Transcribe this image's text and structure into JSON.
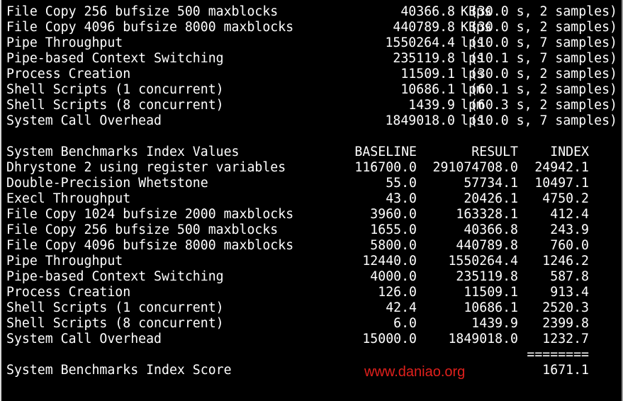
{
  "results": [
    {
      "name": "File Copy 256 bufsize 500 maxblocks",
      "value": "40366.8",
      "unit": "KBps",
      "note": "(30.0 s, 2 samples)"
    },
    {
      "name": "File Copy 4096 bufsize 8000 maxblocks",
      "value": "440789.8",
      "unit": "KBps",
      "note": "(30.0 s, 2 samples)"
    },
    {
      "name": "Pipe Throughput",
      "value": "1550264.4",
      "unit": "lps",
      "note": "(10.0 s, 7 samples)"
    },
    {
      "name": "Pipe-based Context Switching",
      "value": "235119.8",
      "unit": "lps",
      "note": "(10.1 s, 7 samples)"
    },
    {
      "name": "Process Creation",
      "value": "11509.1",
      "unit": "lps",
      "note": "(30.0 s, 2 samples)"
    },
    {
      "name": "Shell Scripts (1 concurrent)",
      "value": "10686.1",
      "unit": "lpm",
      "note": "(60.1 s, 2 samples)"
    },
    {
      "name": "Shell Scripts (8 concurrent)",
      "value": "1439.9",
      "unit": "lpm",
      "note": "(60.3 s, 2 samples)"
    },
    {
      "name": "System Call Overhead",
      "value": "1849018.0",
      "unit": "lps",
      "note": "(10.0 s, 7 samples)"
    }
  ],
  "index_table": {
    "title": "System Benchmarks Index Values",
    "headers": {
      "baseline": "BASELINE",
      "result": "RESULT",
      "index": "INDEX"
    },
    "rows": [
      {
        "name": "Dhrystone 2 using register variables",
        "baseline": "116700.0",
        "result": "291074708.0",
        "index": "24942.1"
      },
      {
        "name": "Double-Precision Whetstone",
        "baseline": "55.0",
        "result": "57734.1",
        "index": "10497.1"
      },
      {
        "name": "Execl Throughput",
        "baseline": "43.0",
        "result": "20426.1",
        "index": "4750.2"
      },
      {
        "name": "File Copy 1024 bufsize 2000 maxblocks",
        "baseline": "3960.0",
        "result": "163328.1",
        "index": "412.4"
      },
      {
        "name": "File Copy 256 bufsize 500 maxblocks",
        "baseline": "1655.0",
        "result": "40366.8",
        "index": "243.9"
      },
      {
        "name": "File Copy 4096 bufsize 8000 maxblocks",
        "baseline": "5800.0",
        "result": "440789.8",
        "index": "760.0"
      },
      {
        "name": "Pipe Throughput",
        "baseline": "12440.0",
        "result": "1550264.4",
        "index": "1246.2"
      },
      {
        "name": "Pipe-based Context Switching",
        "baseline": "4000.0",
        "result": "235119.8",
        "index": "587.8"
      },
      {
        "name": "Process Creation",
        "baseline": "126.0",
        "result": "11509.1",
        "index": "913.4"
      },
      {
        "name": "Shell Scripts (1 concurrent)",
        "baseline": "42.4",
        "result": "10686.1",
        "index": "2520.3"
      },
      {
        "name": "Shell Scripts (8 concurrent)",
        "baseline": "6.0",
        "result": "1439.9",
        "index": "2399.8"
      },
      {
        "name": "System Call Overhead",
        "baseline": "15000.0",
        "result": "1849018.0",
        "index": "1232.7"
      }
    ],
    "separator": "========",
    "score_label": "System Benchmarks Index Score",
    "score_value": "1671.1"
  },
  "watermark": {
    "text": "www.daniao.org",
    "color": "#e0201c"
  },
  "colors": {
    "background": "#000000",
    "text": "#ffffff"
  }
}
